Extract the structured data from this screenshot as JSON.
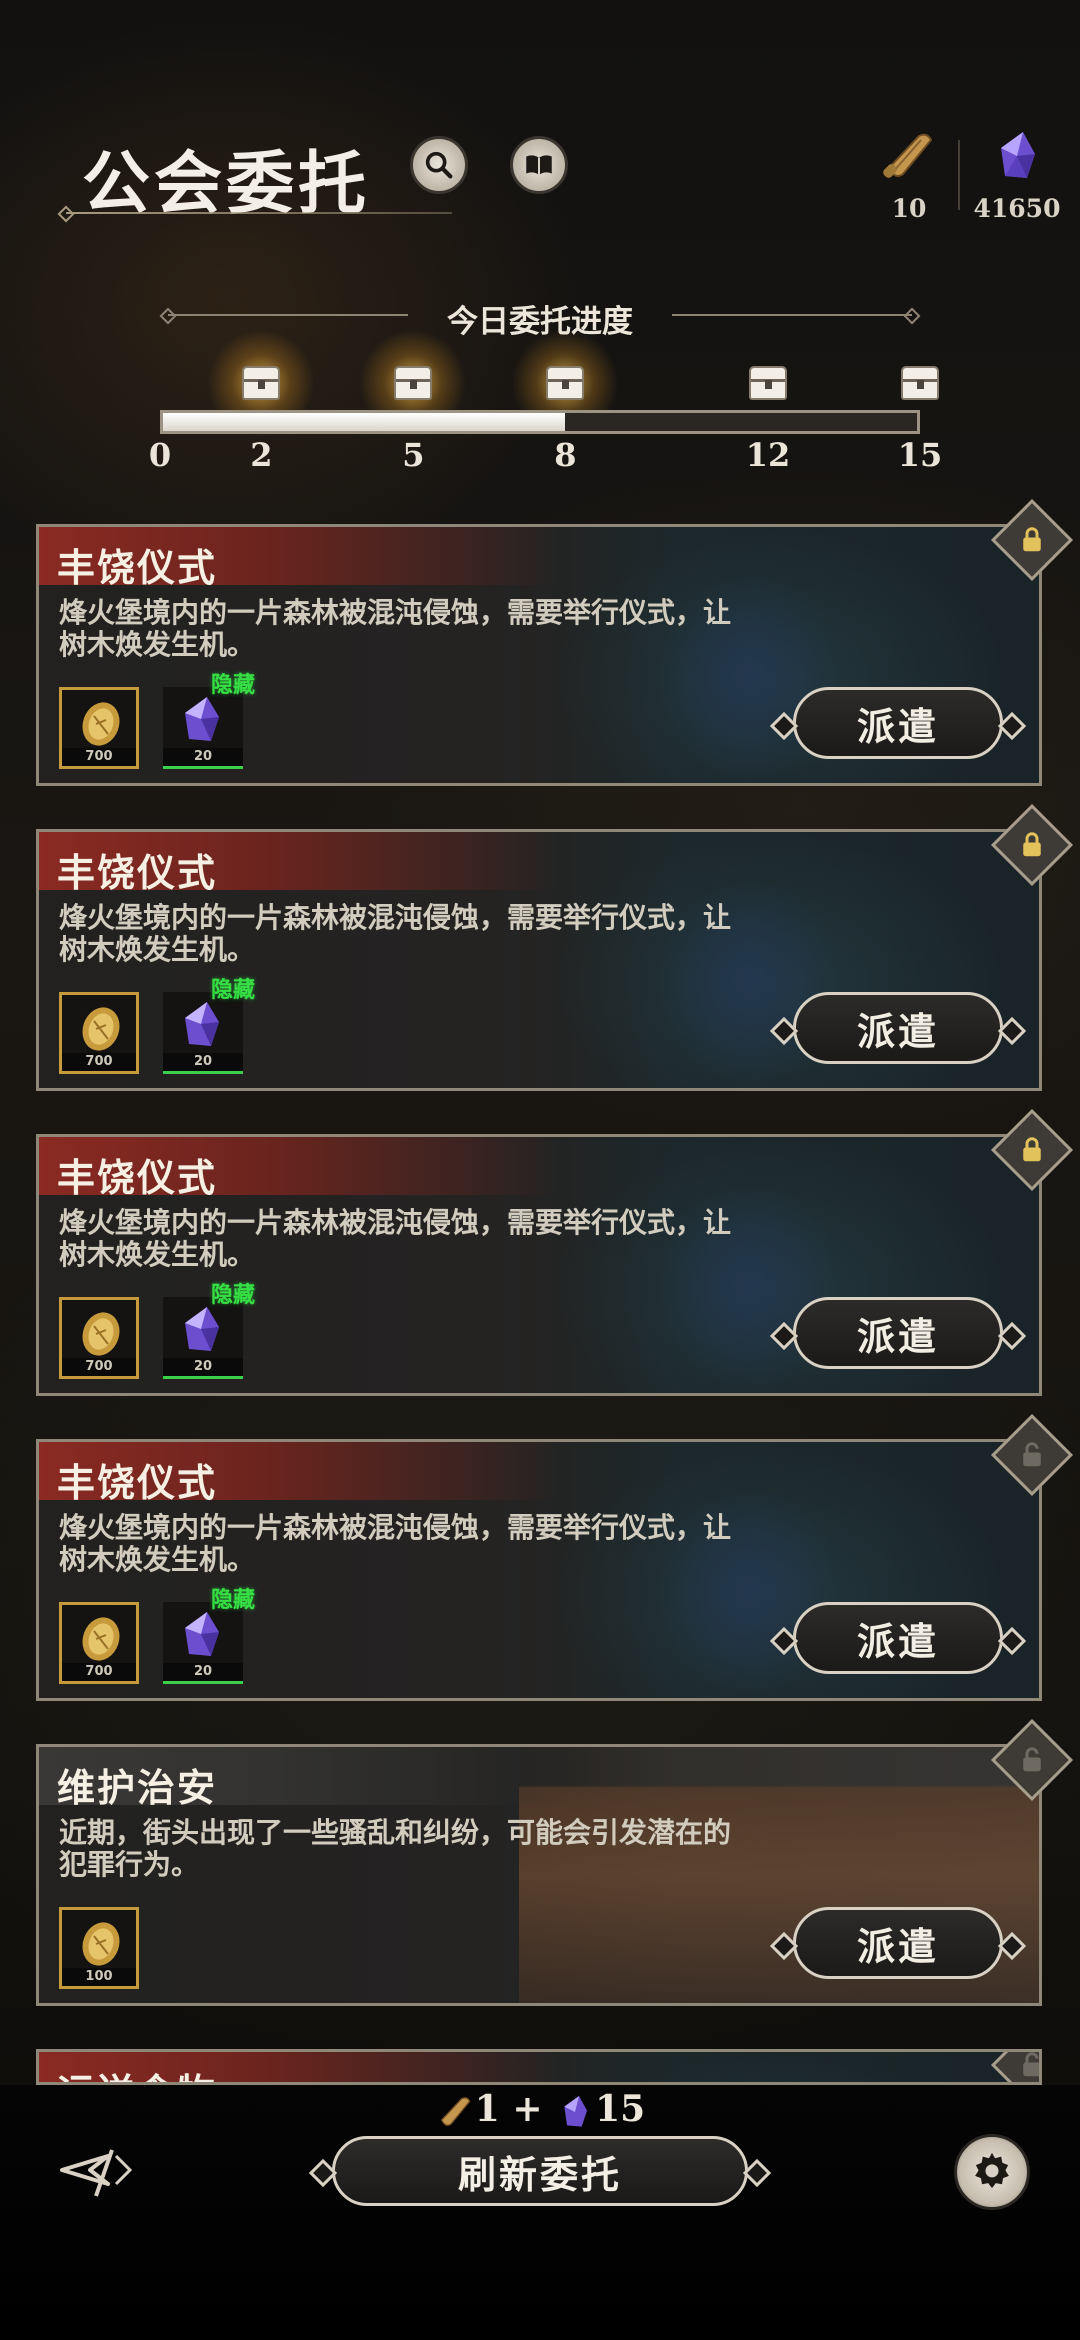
{
  "header": {
    "title": "公会委托",
    "currencies": [
      {
        "icon": "scroll-icon",
        "value": "10"
      },
      {
        "icon": "crystal-icon",
        "value": "41650"
      }
    ]
  },
  "progress": {
    "title": "今日委托进度",
    "current": 8,
    "max": 15,
    "ticks": [
      "0",
      "2",
      "5",
      "8",
      "12",
      "15"
    ],
    "milestones": [
      {
        "at": 2,
        "claimed_glow": true
      },
      {
        "at": 5,
        "claimed_glow": true
      },
      {
        "at": 8,
        "claimed_glow": true
      },
      {
        "at": 12,
        "claimed_glow": false
      },
      {
        "at": 15,
        "claimed_glow": false
      }
    ]
  },
  "commissions": [
    {
      "title": "丰饶仪式",
      "desc": "烽火堡境内的一片森林被混沌侵蚀，需要举行仪式，让树木焕发生机。",
      "locked": true,
      "rewards": [
        {
          "icon": "gold-coin-icon",
          "count": "700"
        },
        {
          "icon": "crystal-icon",
          "count": "20",
          "tag": "隐藏"
        }
      ],
      "button": "派遣"
    },
    {
      "title": "丰饶仪式",
      "desc": "烽火堡境内的一片森林被混沌侵蚀，需要举行仪式，让树木焕发生机。",
      "locked": true,
      "rewards": [
        {
          "icon": "gold-coin-icon",
          "count": "700"
        },
        {
          "icon": "crystal-icon",
          "count": "20",
          "tag": "隐藏"
        }
      ],
      "button": "派遣"
    },
    {
      "title": "丰饶仪式",
      "desc": "烽火堡境内的一片森林被混沌侵蚀，需要举行仪式，让树木焕发生机。",
      "locked": true,
      "rewards": [
        {
          "icon": "gold-coin-icon",
          "count": "700"
        },
        {
          "icon": "crystal-icon",
          "count": "20",
          "tag": "隐藏"
        }
      ],
      "button": "派遣"
    },
    {
      "title": "丰饶仪式",
      "desc": "烽火堡境内的一片森林被混沌侵蚀，需要举行仪式，让树木焕发生机。",
      "locked": false,
      "rewards": [
        {
          "icon": "gold-coin-icon",
          "count": "700"
        },
        {
          "icon": "crystal-icon",
          "count": "20",
          "tag": "隐藏"
        }
      ],
      "button": "派遣"
    },
    {
      "title": "维护治安",
      "desc": "近期，街头出现了一些骚乱和纠纷，可能会引发潜在的犯罪行为。",
      "locked": false,
      "rewards": [
        {
          "icon": "gold-coin-icon",
          "count": "100"
        }
      ],
      "button": "派遣"
    },
    {
      "title": "运送食物",
      "locked": false
    }
  ],
  "footer": {
    "cost_scroll": "1",
    "cost_plus": "+",
    "cost_crystal": "15",
    "refresh_label": "刷新委托"
  },
  "colors": {
    "card_title_red": "#8a2a22",
    "reward_gold_frame": "#c59a3a",
    "hidden_tag_green": "#36e044"
  }
}
